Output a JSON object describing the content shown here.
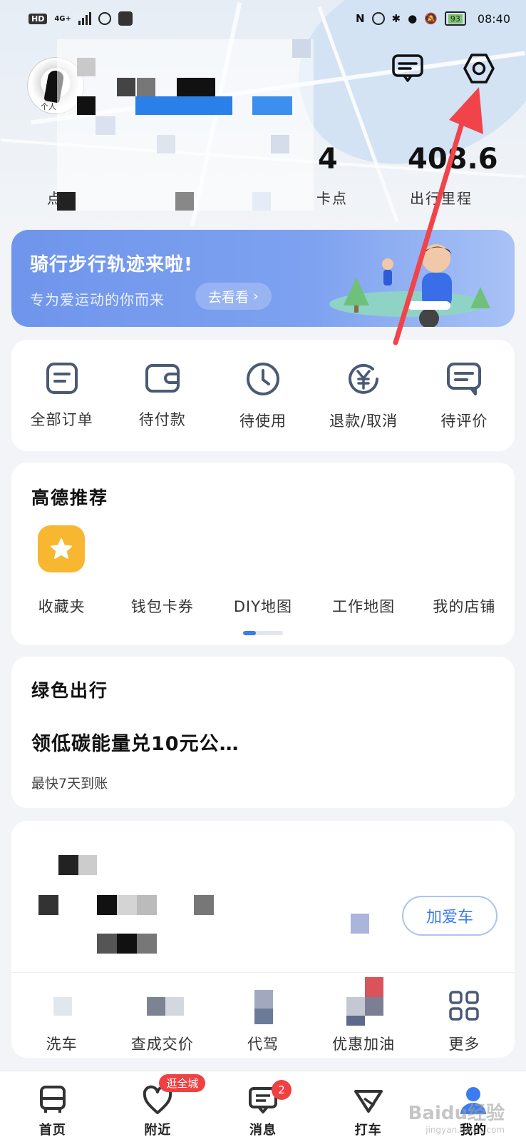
{
  "status_bar": {
    "hd_badge": "HD",
    "network": "4G+",
    "battery": "93",
    "time": "08:40"
  },
  "header": {
    "stat_value_1": "4",
    "stat_label_1": "卡点",
    "stat_value_2": "408.6",
    "stat_label_2": "出行里程",
    "avatar_caption": "个人",
    "stat_label_left": "点"
  },
  "banner": {
    "title": "骑行步行轨迹来啦!",
    "subtitle": "专为爱运动的你而来",
    "button": "去看看"
  },
  "orders": {
    "items": [
      {
        "label": "全部订单",
        "icon": "order-list-icon"
      },
      {
        "label": "待付款",
        "icon": "wallet-icon"
      },
      {
        "label": "待使用",
        "icon": "clock-icon"
      },
      {
        "label": "退款/取消",
        "icon": "refund-yen-icon"
      },
      {
        "label": "待评价",
        "icon": "comment-icon"
      }
    ]
  },
  "recommend": {
    "title": "高德推荐",
    "items": [
      {
        "label": "收藏夹",
        "icon": "star-icon"
      },
      {
        "label": "钱包卡券",
        "icon": ""
      },
      {
        "label": "DIY地图",
        "icon": ""
      },
      {
        "label": "工作地图",
        "icon": ""
      },
      {
        "label": "我的店铺",
        "icon": ""
      }
    ]
  },
  "green": {
    "title": "绿色出行",
    "headline": "领低碳能量兑10元公…",
    "subtitle": "最快7天到账"
  },
  "car": {
    "add_button": "加爱车",
    "items": [
      {
        "label": "洗车"
      },
      {
        "label": "查成交价"
      },
      {
        "label": "代驾"
      },
      {
        "label": "优惠加油"
      },
      {
        "label": "更多"
      }
    ]
  },
  "nav": {
    "items": [
      {
        "label": "首页"
      },
      {
        "label": "附近",
        "badge": "逛全城"
      },
      {
        "label": "消息",
        "badge": "2"
      },
      {
        "label": "打车"
      },
      {
        "label": "我的"
      }
    ]
  },
  "watermark": {
    "main": "Baidu经验",
    "sub": "jingyan.baidu.com"
  },
  "colors": {
    "accent": "#3b7cf0",
    "banner": "#7ea2f0",
    "badge": "#f04142",
    "star": "#f8b731",
    "icon": "#4a5a75",
    "arrow": "#f0444a"
  }
}
